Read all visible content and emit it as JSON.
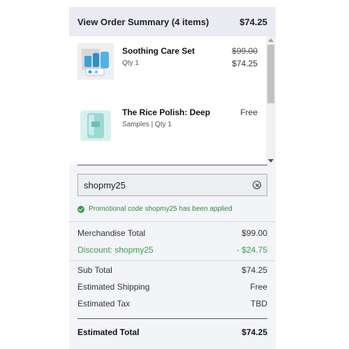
{
  "header": {
    "title": "View Order Summary (4 items)",
    "total": "$74.25"
  },
  "items": [
    {
      "name": "Soothing Care Set",
      "details": "Qty 1",
      "original_price": "$99.00",
      "price": "$74.25"
    },
    {
      "name": "The Rice Polish: Deep",
      "details": "Samples |  Qty 1",
      "price": "Free"
    }
  ],
  "promo": {
    "code": "shopmy25",
    "message": "Promotional code shopmy25 has been applied"
  },
  "summary": {
    "merchandise_label": "Merchandise Total",
    "merchandise_value": "$99.00",
    "discount_label": "Discount: shopmy25",
    "discount_value": "- $24.75",
    "subtotal_label": "Sub Total",
    "subtotal_value": "$74.25",
    "shipping_label": "Estimated Shipping",
    "shipping_value": "Free",
    "tax_label": "Estimated Tax",
    "tax_value": "TBD",
    "total_label": "Estimated Total",
    "total_value": "$74.25"
  },
  "colors": {
    "accent_green": "#2f9e44",
    "header_bg": "#eaebf3",
    "panel_bg": "#f3f4f8"
  }
}
